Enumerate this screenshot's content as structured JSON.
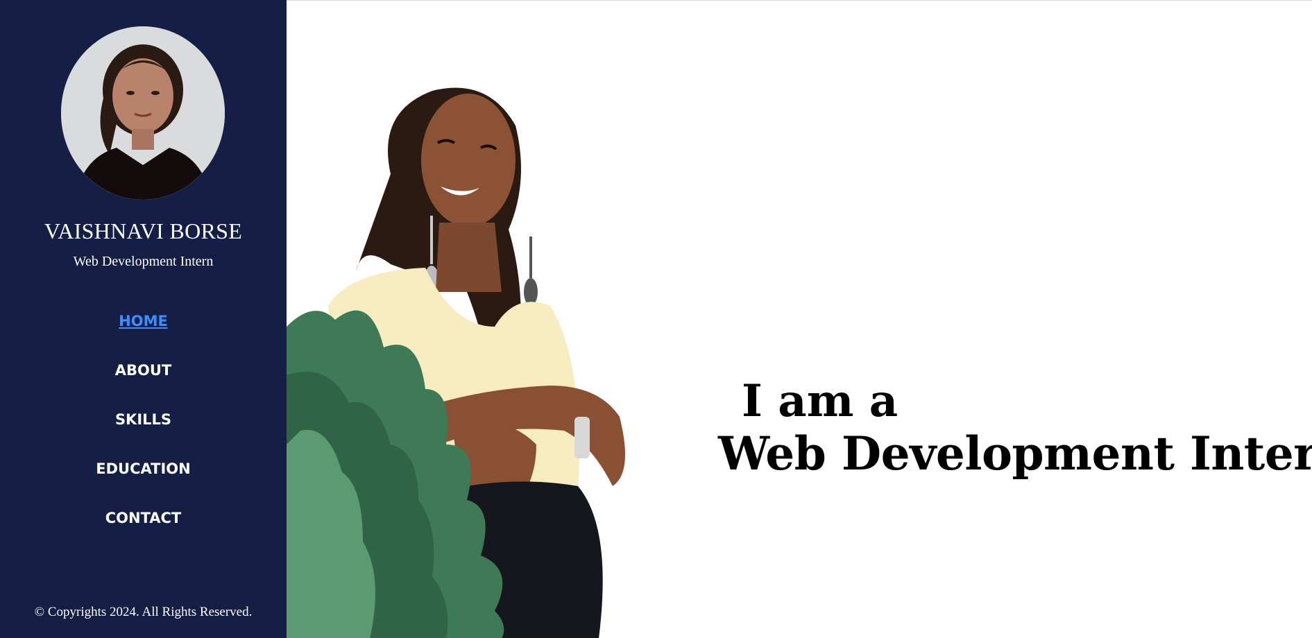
{
  "profile": {
    "name": "VAISHNAVI BORSE",
    "role": "Web Development Intern",
    "avatar_icon": "profile-photo"
  },
  "nav": {
    "items": [
      {
        "label": "HOME",
        "active": true
      },
      {
        "label": "ABOUT",
        "active": false
      },
      {
        "label": "SKILLS",
        "active": false
      },
      {
        "label": "EDUCATION",
        "active": false
      },
      {
        "label": "CONTACT",
        "active": false
      }
    ]
  },
  "footer": {
    "copyright": "© Copyrights 2024. All Rights Reserved."
  },
  "hero": {
    "line1": "I am a",
    "line2": "Web Development Intern",
    "photo_icon": "hero-photo"
  },
  "colors": {
    "sidebar_bg": "#151f45",
    "active_link": "#3c8dff",
    "text_light": "#ffffff",
    "headline": "#000000"
  }
}
